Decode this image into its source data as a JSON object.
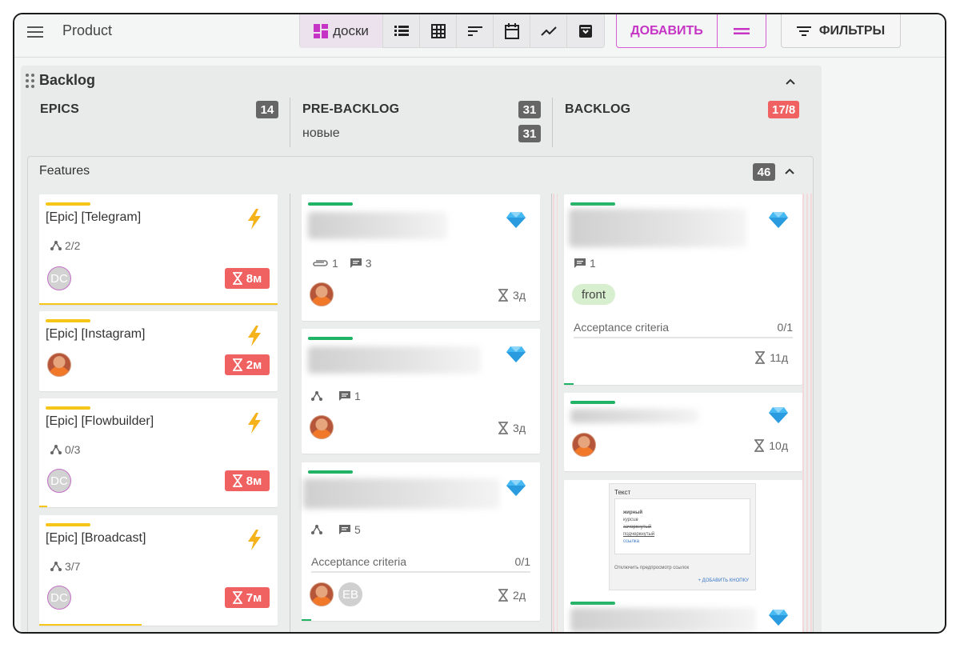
{
  "topbar": {
    "app_title": "Product",
    "views": [
      {
        "name": "boards",
        "label": "доски",
        "icon": "board-icon",
        "active": true
      },
      {
        "name": "list",
        "icon": "list-icon"
      },
      {
        "name": "table",
        "icon": "table-icon"
      },
      {
        "name": "sort",
        "icon": "sort-icon"
      },
      {
        "name": "calendar",
        "icon": "calendar-icon"
      },
      {
        "name": "chart",
        "icon": "chart-icon"
      },
      {
        "name": "archive",
        "icon": "archive-icon"
      }
    ],
    "add_label": "ДОБАВИТЬ",
    "filters_label": "ФИЛЬТРЫ",
    "accent": "#c534c5"
  },
  "board": {
    "title": "Backlog",
    "columns": [
      {
        "name": "EPICS",
        "count": "14"
      },
      {
        "name": "PRE-BACKLOG",
        "count": "31",
        "sub_label": "новые",
        "sub_count": "31"
      },
      {
        "name": "BACKLOG",
        "count": "17/8",
        "count_color": "#f06262"
      }
    ],
    "features": {
      "title": "Features",
      "count": "46"
    }
  },
  "epics": [
    {
      "title": "[Epic] [Telegram]",
      "subtasks": "2/2",
      "avatar": "DC",
      "timer": "8м"
    },
    {
      "title": "[Epic] [Instagram]",
      "avatar_photo": true,
      "timer": "2м"
    },
    {
      "title": "[Epic] [Flowbuilder]",
      "subtasks": "0/3",
      "avatar": "DC",
      "timer": "8м"
    },
    {
      "title": "[Epic] [Broadcast]",
      "subtasks": "3/7",
      "avatar": "DC",
      "timer": "7м"
    }
  ],
  "prebacklog": [
    {
      "attachments": "1",
      "comments": "3",
      "timer": "3д"
    },
    {
      "comments": "1",
      "timer": "3д"
    },
    {
      "comments": "5",
      "acceptance_label": "Acceptance criteria",
      "acceptance_value": "0/1",
      "avatar2": "EB",
      "timer": "2д"
    }
  ],
  "backlog": [
    {
      "comments": "1",
      "tag": "front",
      "acceptance_label": "Acceptance criteria",
      "acceptance_value": "0/1",
      "timer": "11д"
    },
    {
      "timer": "10д"
    },
    {
      "mock": {
        "header": "Текст",
        "lines": [
          "жирный",
          "курсив",
          "зачеркнутый",
          "подчеркнутый",
          "ссылка"
        ],
        "checkbox": "Отключить предпросмотр ссылок",
        "button": "+ ДОБАВИТЬ КНОПКУ"
      }
    }
  ]
}
